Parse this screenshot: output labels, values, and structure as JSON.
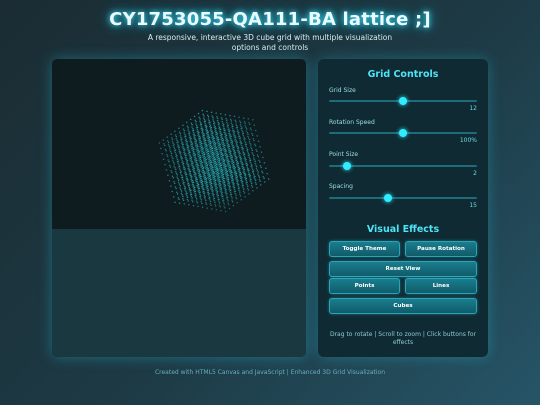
{
  "header": {
    "title": "CY1753055-QA111-BA lattice ;]",
    "subtitle": "A responsive, interactive 3D cube grid with multiple visualization options and controls"
  },
  "controls": {
    "title": "Grid Controls",
    "sliders": [
      {
        "label": "Grid Size",
        "value": "12",
        "fraction": 0.5
      },
      {
        "label": "Rotation Speed",
        "value": "100%",
        "fraction": 0.5
      },
      {
        "label": "Point Size",
        "value": "2",
        "fraction": 0.12
      },
      {
        "label": "Spacing",
        "value": "15",
        "fraction": 0.4
      }
    ]
  },
  "effects": {
    "title": "Visual Effects",
    "toggle_theme": "Toggle Theme",
    "pause_rotation": "Pause Rotation",
    "reset_view": "Reset View",
    "points": "Points",
    "lines": "Lines",
    "cubes": "Cubes"
  },
  "hint": "Drag to rotate | Scroll to zoom | Click buttons for effects",
  "footer": "Created with HTML5 Canvas and JavaScript | Enhanced 3D Grid Visualization",
  "colors": {
    "accent": "#31ecff",
    "lattice": "#2fc6cf",
    "panel": "#0f2a33",
    "button": "#137080"
  }
}
